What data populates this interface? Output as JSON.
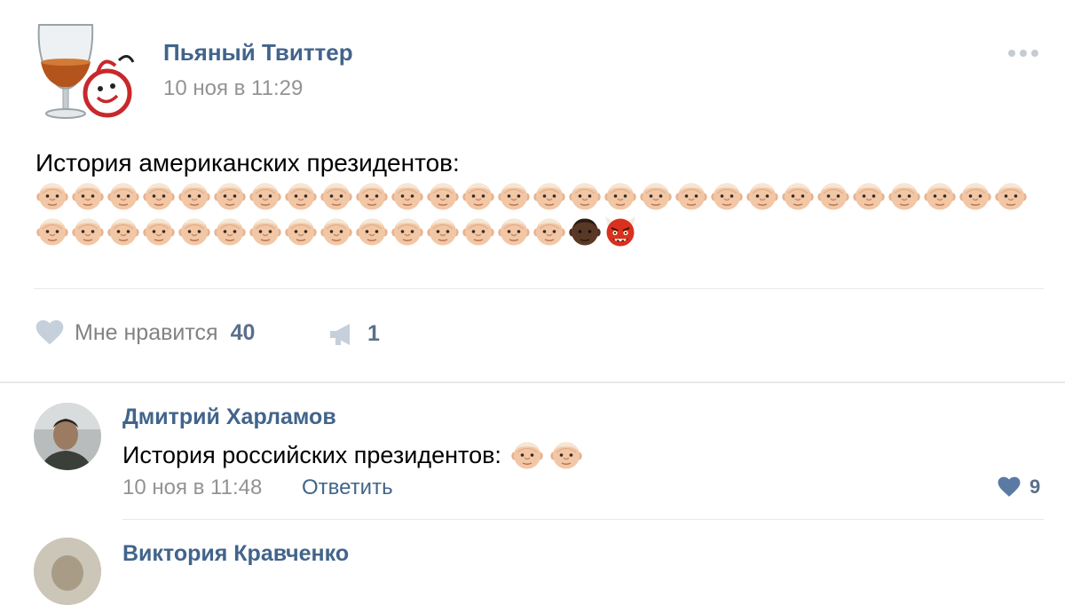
{
  "post": {
    "author": "Пьяный Твиттер",
    "time": "10 ноя в 11:29",
    "text": "История американских президентов:",
    "emoji_rows": [
      [
        "man",
        "man",
        "man",
        "man",
        "man",
        "man",
        "man",
        "man",
        "man",
        "man",
        "man",
        "man",
        "man",
        "man",
        "man",
        "man",
        "man",
        "man",
        "man",
        "man",
        "man",
        "man",
        "man",
        "man",
        "man",
        "man",
        "man",
        "man"
      ],
      [
        "man",
        "man",
        "man",
        "man",
        "man",
        "man",
        "man",
        "man",
        "man",
        "man",
        "man",
        "man",
        "man",
        "man",
        "man",
        "dark-man",
        "ogre"
      ]
    ],
    "likes_label": "Мне нравится",
    "likes_count": "40",
    "shares_count": "1"
  },
  "comments": [
    {
      "author": "Дмитрий Харламов",
      "text": "История российских президентов:",
      "emoji": [
        "man",
        "man"
      ],
      "time": "10 ноя в 11:48",
      "reply_label": "Ответить",
      "likes_count": "9"
    },
    {
      "author": "Виктория Кравченко"
    }
  ],
  "colors": {
    "link": "#42648b",
    "meta": "#939393",
    "icon": "#c5d0db",
    "liked_icon": "#5b7aa3"
  },
  "icons": {
    "like": "heart-icon",
    "share": "megaphone-icon",
    "more": "more-dots-icon"
  }
}
